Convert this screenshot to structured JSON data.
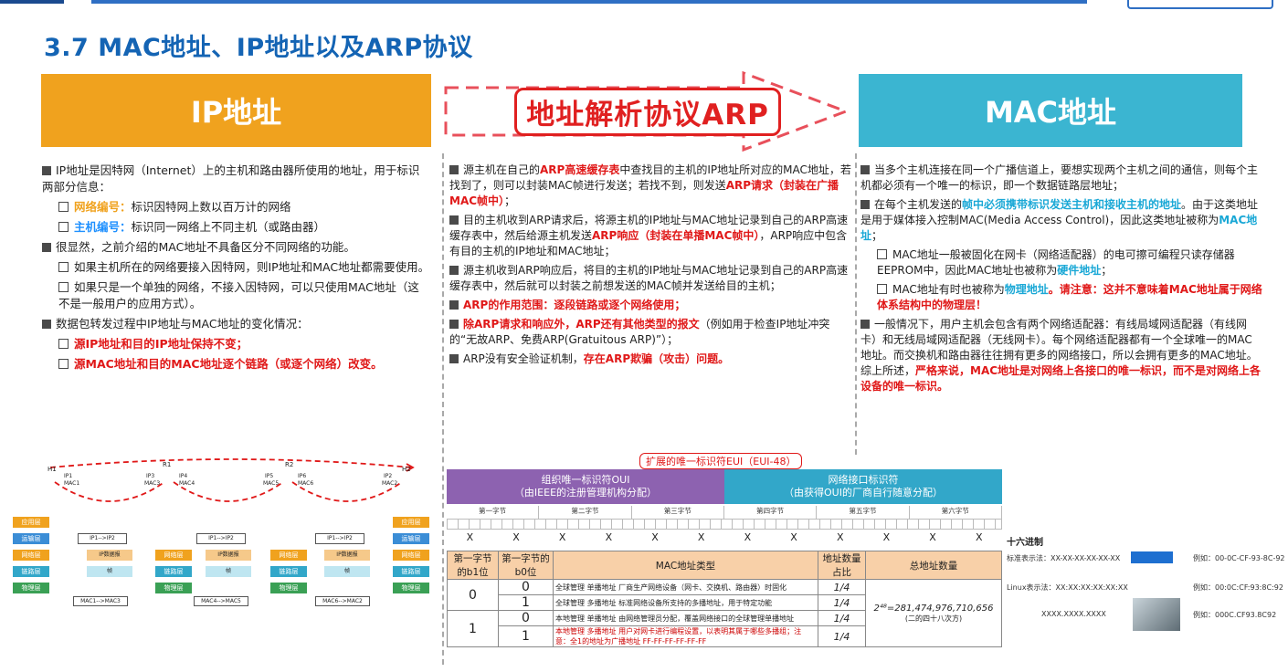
{
  "page_title": "3.7 MAC地址、IP地址以及ARP协议",
  "headers": {
    "ip": "IP地址",
    "arp": "地址解析协议ARP",
    "mac": "MAC地址"
  },
  "ip_col": {
    "p1": "IP地址是因特网（Internet）上的主机和路由器所使用的地址，用于标识两部分信息：",
    "p1a_key": "网络编号：",
    "p1a_text": "标识因特网上数以百万计的网络",
    "p1b_key": "主机编号：",
    "p1b_text": "标识同一网络上不同主机（或路由器）",
    "p2": "很显然，之前介绍的MAC地址不具备区分不同网络的功能。",
    "p2a": "如果主机所在的网络要接入因特网，则IP地址和MAC地址都需要使用。",
    "p2b": "如果只是一个单独的网络，不接入因特网，可以只使用MAC地址（这不是一般用户的应用方式）。",
    "p3": "数据包转发过程中IP地址与MAC地址的变化情况：",
    "p3a": "源IP地址和目的IP地址保持不变；",
    "p3b": "源MAC地址和目的MAC地址逐个链路（或逐个网络）改变。"
  },
  "arp_col": {
    "p1a": "源主机在自己的",
    "p1b": "ARP高速缓存表",
    "p1c": "中查找目的主机的IP地址所对应的MAC地址，若找到了，则可以封装MAC帧进行发送；若找不到，则发送",
    "p1d": "ARP请求（封装在广播MAC帧中）",
    "p1e": "；",
    "p2a": "目的主机收到ARP请求后，将源主机的IP地址与MAC地址记录到自己的ARP高速缓存表中，然后给源主机发送",
    "p2b": "ARP响应（封装在单播MAC帧中）",
    "p2c": "，ARP响应中包含有目的主机的IP地址和MAC地址；",
    "p3": "源主机收到ARP响应后，将目的主机的IP地址与MAC地址记录到自己的ARP高速缓存表中，然后就可以封装之前想发送的MAC帧并发送给目的主机；",
    "p4": "ARP的作用范围：逐段链路或逐个网络使用；",
    "p5a": "除ARP请求和响应外，ARP还有其他类型的报文",
    "p5b": "（例如用于检查IP地址冲突的“无故ARP、免费ARP(Gratuitous ARP)”）；",
    "p6a": "ARP没有安全验证机制，",
    "p6b": "存在ARP欺骗（攻击）问题。"
  },
  "mac_col": {
    "p1": "当多个主机连接在同一个广播信道上，要想实现两个主机之间的通信，则每个主机都必须有一个唯一的标识，即一个数据链路层地址；",
    "p2a": "在每个主机发送的",
    "p2b": "帧中必须携带标识发送主机和接收主机的地址",
    "p2c": "。由于这类地址是用于媒体接入控制MAC(Media Access Control)，因此这类地址被称为",
    "p2d": "MAC地址",
    "p2e": "；",
    "p2f": "MAC地址一般被固化在网卡（网络适配器）的电可擦可编程只读存储器EEPROM中，因此MAC地址也被称为",
    "p2g": "硬件地址",
    "p2h": "；",
    "p2i": "MAC地址有时也被称为",
    "p2j": "物理地址",
    "p2k": "。请注意：这并不意味着MAC地址属于网络体系结构中的物理层！",
    "p3a": "一般情况下，用户主机会包含有两个网络适配器：有线局域网适配器（有线网卡）和无线局域网适配器（无线网卡）。每个网络适配器都有一个全球唯一的MAC地址。而交换机和路由器往往拥有更多的网络接口，所以会拥有更多的MAC地址。综上所述，",
    "p3b": "严格来说，MAC地址是对网络上各接口的唯一标识，而不是对网络上各设备的唯一标识。"
  },
  "eui": {
    "label": "扩展的唯一标识符EUI（EUI-48）",
    "oui_line1": "组织唯一标识符OUI",
    "oui_line2": "（由IEEE的注册管理机构分配）",
    "nic_line1": "网络接口标识符",
    "nic_line2": "（由获得OUI的厂商自行随意分配）",
    "bytes": [
      "第一字节",
      "第二字节",
      "第三字节",
      "第四字节",
      "第五字节",
      "第六字节"
    ],
    "x": [
      "X",
      "X",
      "X",
      "X",
      "X",
      "X",
      "X",
      "X",
      "X",
      "X",
      "X",
      "X"
    ],
    "hex_label": "十六进制"
  },
  "mac_table": {
    "headers": [
      "第一字节的b1位",
      "第一字节的b0位",
      "MAC地址类型",
      "地址数量占比",
      "总地址数量"
    ],
    "rows": [
      {
        "b1": "0",
        "b0": "0",
        "type": "全球管理 单播地址 厂商生产网络设备（网卡、交换机、路由器）时固化",
        "ratio": "1/4"
      },
      {
        "b1": "",
        "b0": "1",
        "type": "全球管理 多播地址 标准网络设备所支持的多播地址，用于特定功能",
        "ratio": "1/4"
      },
      {
        "b1": "1",
        "b0": "0",
        "type": "本地管理 单播地址 由网络管理员分配，覆盖网络接口的全球管理单播地址",
        "ratio": "1/4"
      },
      {
        "b1": "",
        "b0": "1",
        "type": "本地管理 多播地址 用户对网卡进行编程设置，以表明其属于哪些多播组；注意：全1的地址为广播地址 FF-FF-FF-FF-FF-FF",
        "ratio": "1/4"
      }
    ],
    "total": "2⁴⁸=281,474,976,710,656",
    "total_note": "(二的四十八次方)"
  },
  "formats": [
    {
      "label": "标准表示法：XX-XX-XX-XX-XX-XX",
      "example": "例如：00-0C-CF-93-8C-92"
    },
    {
      "label": "Linux表示法：XX:XX:XX:XX:XX:XX",
      "example": "例如：00:0C:CF:93:8C:92"
    },
    {
      "label": "XXXX.XXXX.XXXX",
      "example": "例如：000C.CF93.8C92"
    }
  ],
  "diagram": {
    "nodes": [
      "H1",
      "R1",
      "R2",
      "H2"
    ],
    "ip_labels": [
      "IP1",
      "IP3",
      "IP4",
      "IP5",
      "IP6",
      "IP2"
    ],
    "mac_labels": [
      "MAC1",
      "MAC3",
      "MAC4",
      "MAC5",
      "MAC6",
      "MAC2"
    ],
    "layers": [
      "应用层",
      "运输层",
      "网络层",
      "链路层",
      "物理层"
    ],
    "ip_flow": [
      "IP1-->IP2",
      "IP1-->IP2",
      "IP1-->IP2"
    ],
    "mac_flow": [
      "MAC1-->MAC3",
      "MAC4-->MAC5",
      "MAC6-->MAC2"
    ],
    "pkt": "IP数据报",
    "frame": "帧"
  }
}
